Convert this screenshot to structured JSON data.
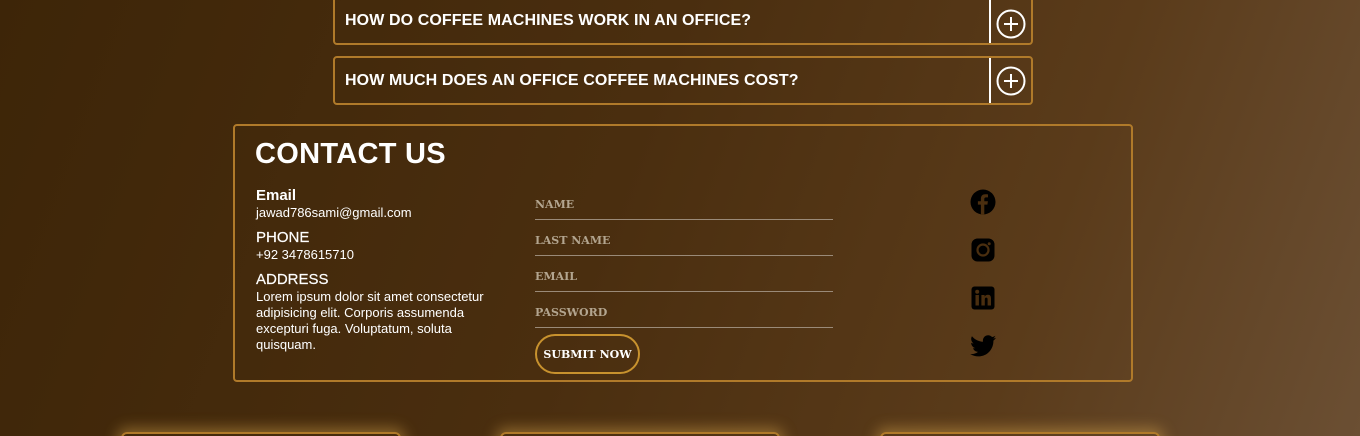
{
  "faq": [
    {
      "question": "HOW DO COFFEE MACHINES WORK IN AN OFFICE?"
    },
    {
      "question": "HOW MUCH DOES AN OFFICE COFFEE MACHINES COST?"
    }
  ],
  "contact": {
    "title": "CONTACT US",
    "email_label": "Email",
    "email_value": "jawad786sami@gmail.com",
    "phone_label": "PHONE",
    "phone_value": "+92 3478615710",
    "address_label": "ADDRESS",
    "address_value": "Lorem ipsum dolor sit amet consectetur adipisicing elit. Corporis assumenda excepturi fuga. Voluptatum, soluta quisquam."
  },
  "form": {
    "name_placeholder": "NAME",
    "last_name_placeholder": "LAST NAME",
    "email_placeholder": "EMAIL",
    "password_placeholder": "PASSWORD",
    "submit_label": "SUBMIT NOW"
  },
  "social": [
    "facebook-icon",
    "instagram-icon",
    "linkedin-icon",
    "twitter-icon"
  ],
  "colors": {
    "accent": "#b07a2a",
    "background": "#4a2e0f"
  }
}
